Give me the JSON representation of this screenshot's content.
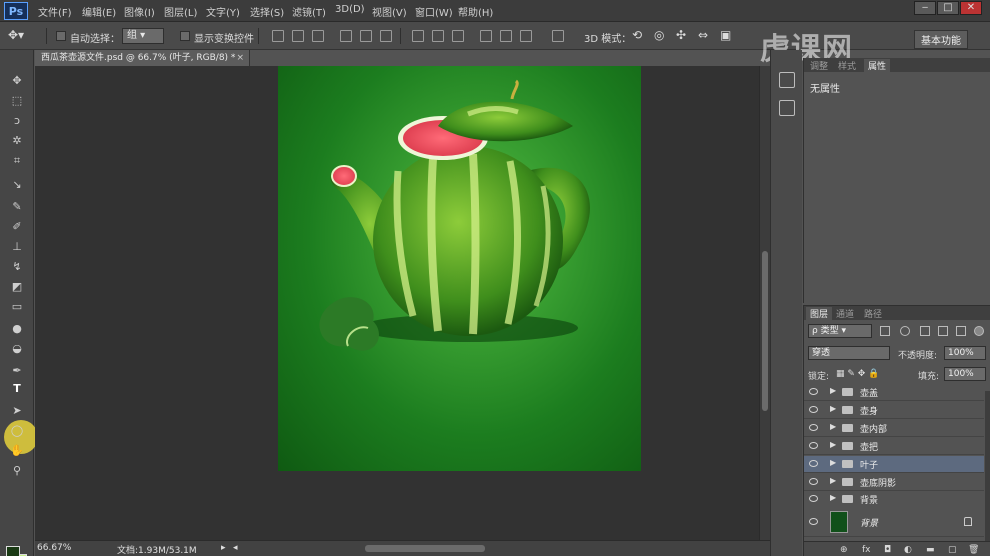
{
  "app": {
    "logo": "Ps"
  },
  "menu": [
    "文件(F)",
    "编辑(E)",
    "图像(I)",
    "图层(L)",
    "文字(Y)",
    "选择(S)",
    "滤镜(T)",
    "3D(D)",
    "视图(V)",
    "窗口(W)",
    "帮助(H)"
  ],
  "window_controls": {
    "minimize": "‒",
    "maximize": "□",
    "close": "✕"
  },
  "options": {
    "auto_select_label": "自动选择：",
    "auto_select_value": "组",
    "show_transform_label": "显示变换控件",
    "mode_3d_label": "3D 模式："
  },
  "watermark": "虎课网",
  "workspace": "基本功能",
  "document": {
    "tab_title": "西瓜茶壶源文件.psd @ 66.7% (叶子, RGB/8) *",
    "tab_close": "×"
  },
  "status": {
    "zoom": "66.67%",
    "doc_info": "文档:1.93M/53.1M"
  },
  "colors": {
    "foreground": "#1a3a14",
    "background": "#c6f08c"
  },
  "tools": [
    "move-tool",
    "marquee-tool",
    "lasso-tool",
    "magic-wand-tool",
    "crop-tool",
    "eyedropper-tool",
    "healing-brush-tool",
    "brush-tool",
    "clone-stamp-tool",
    "history-brush-tool",
    "eraser-tool",
    "gradient-tool",
    "blur-tool",
    "dodge-tool",
    "pen-tool",
    "type-tool",
    "path-selection-tool",
    "ellipse-tool",
    "hand-tool",
    "zoom-tool"
  ],
  "type_tool_glyph": "T",
  "properties": {
    "tabs": [
      "调整",
      "样式",
      "属性"
    ],
    "active_tab": "属性",
    "content": "无属性"
  },
  "layers_panel": {
    "tabs": [
      "图层",
      "通道",
      "路径"
    ],
    "filter_label": "ρ 类型",
    "blend_mode": "穿透",
    "opacity_label": "不透明度:",
    "opacity_value": "100%",
    "lock_label": "锁定:",
    "fill_label": "填充:",
    "fill_value": "100%",
    "groups": [
      {
        "name": "壶盖",
        "selected": false
      },
      {
        "name": "壶身",
        "selected": false
      },
      {
        "name": "壶内部",
        "selected": false
      },
      {
        "name": "壶把",
        "selected": false
      },
      {
        "name": "叶子",
        "selected": true
      },
      {
        "name": "壶底阴影",
        "selected": false
      },
      {
        "name": "背景",
        "selected": false
      }
    ],
    "background_layer": "背景",
    "footer_icons": [
      "link-icon",
      "fx-icon",
      "mask-icon",
      "adjustment-icon",
      "folder-icon",
      "new-layer-icon",
      "trash-icon"
    ],
    "footer_labels": [
      "⊕",
      "fx",
      "◘",
      "◐",
      "▬",
      "▢",
      "🗑"
    ]
  }
}
